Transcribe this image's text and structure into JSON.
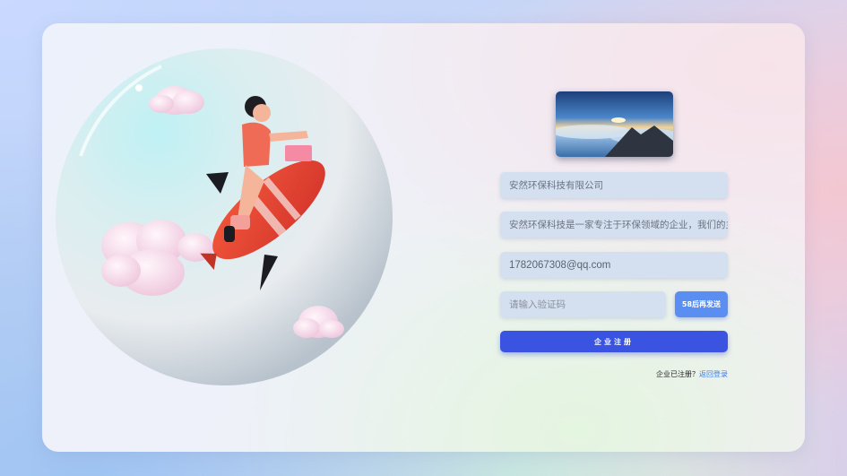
{
  "form": {
    "company_name_value": "安然环保科技有限公司",
    "company_intro_value": "安然环保科技是一家专注于环保领域的企业，我们的主",
    "email_value": "1782067308@qq.com",
    "code_placeholder": "请输入验证码",
    "send_code_label": "58后再发送",
    "register_label": "企业注册",
    "already_registered_text": "企业已注册？",
    "login_link_label": "返回登录"
  },
  "images": {
    "illustration": "rocket-rider-in-bubble",
    "banner": "mountain-sunrise-sea-of-clouds"
  },
  "colors": {
    "primary": "#3a54e1",
    "send_button": "#5a8ef0",
    "field_bg": "#d4dff0",
    "link": "#3a7ce8"
  }
}
